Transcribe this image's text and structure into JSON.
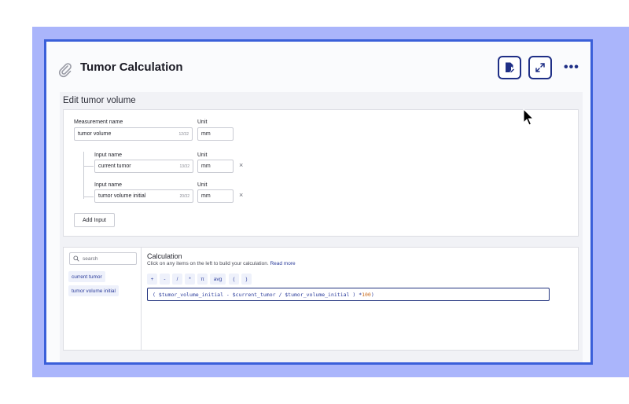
{
  "header": {
    "title": "Tumor Calculation",
    "more_label": "•••"
  },
  "edit_section": {
    "title": "Edit tumor volume",
    "measurement": {
      "name_label": "Measurement name",
      "name_value": "tumor volume",
      "name_count": "12/32",
      "unit_label": "Unit",
      "unit_value": "mm"
    },
    "inputs": [
      {
        "name_label": "Input name",
        "name_value": "current tumor",
        "name_count": "13/32",
        "unit_label": "Unit",
        "unit_value": "mm"
      },
      {
        "name_label": "Input name",
        "name_value": "tumor volume initial",
        "name_count": "20/32",
        "unit_label": "Unit",
        "unit_value": "mm"
      }
    ],
    "remove_icon": "×",
    "add_input_label": "Add Input"
  },
  "calc_section": {
    "search_placeholder": "search",
    "variables": [
      "current tumor",
      "tumor volume initial"
    ],
    "title": "Calculation",
    "subtitle": "Click on any items on the left to build your calculation.",
    "read_more": "Read more",
    "operators": [
      "+",
      "-",
      "/",
      "*",
      "π",
      "avg",
      "(",
      ")"
    ],
    "formula_text": "( $tumor_volume_initial - $current_tumor / $tumor_volume_initial ) *",
    "formula_number": "100",
    "formula_close": ")"
  },
  "colors": {
    "accent": "#3a5fd9",
    "backdrop": "#aab5fb",
    "button_border": "#1f2f86"
  },
  "icons": [
    "paperclip-icon",
    "edit-document-icon",
    "expand-icon",
    "more-icon",
    "search-icon",
    "close-icon",
    "mouse-cursor-icon"
  ]
}
